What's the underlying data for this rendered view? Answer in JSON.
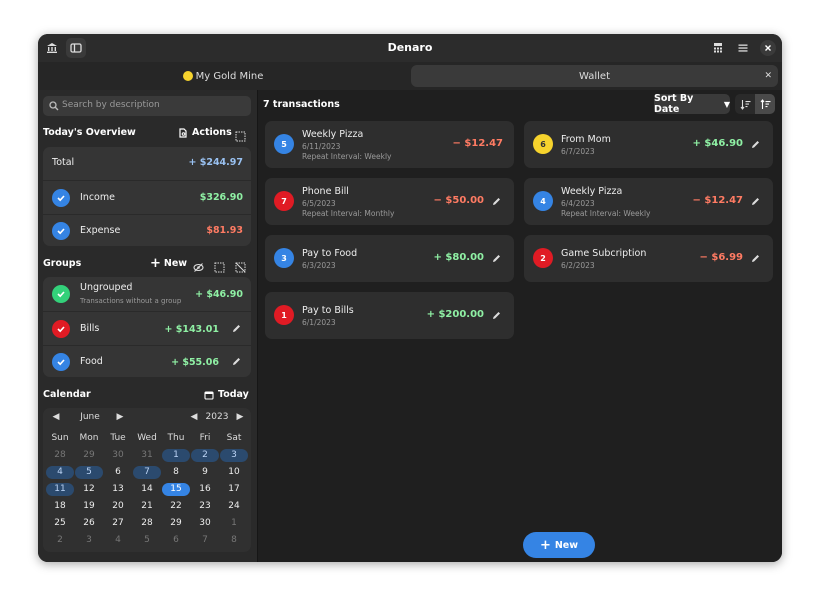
{
  "app": {
    "title": "Denaro"
  },
  "colors": {
    "accent": "#3584e4",
    "positive": "#8ff0a4",
    "negative": "#ff7b63",
    "red_badge": "#e01b24",
    "yellow_badge": "#f6d32d",
    "green_badge": "#33d17a"
  },
  "icons": {
    "bank": "bank-icon",
    "sidebar": "sidebar-toggle-icon",
    "calculator": "calculator-icon",
    "menu": "hamburger-menu-icon",
    "close": "close-icon"
  },
  "tabs": [
    {
      "label": "My Gold Mine",
      "dot_color": "#f6d32d"
    },
    {
      "label": "Wallet"
    }
  ],
  "search": {
    "placeholder": "Search by description"
  },
  "overview": {
    "title": "Today's Overview",
    "actions_label": "Actions",
    "rows": [
      {
        "label": "Total",
        "amount": "+ $244.97"
      },
      {
        "label": "Income",
        "amount": "$326.90"
      },
      {
        "label": "Expense",
        "amount": "$81.93"
      }
    ]
  },
  "groups": {
    "title": "Groups",
    "new_label": "New",
    "items": [
      {
        "name": "Ungrouped",
        "subtitle": "Transactions without a group",
        "amount": "+ $46.90",
        "color": "#33d17a"
      },
      {
        "name": "Bills",
        "amount": "+ $143.01",
        "color": "#e01b24"
      },
      {
        "name": "Food",
        "amount": "+ $55.06",
        "color": "#3584e4"
      }
    ]
  },
  "calendar": {
    "title": "Calendar",
    "today_label": "Today",
    "month": "June",
    "year": "2023",
    "weekdays": [
      "Sun",
      "Mon",
      "Tue",
      "Wed",
      "Thu",
      "Fri",
      "Sat"
    ],
    "weeks": [
      [
        "28",
        "29",
        "30",
        "31",
        "1",
        "2",
        "3"
      ],
      [
        "4",
        "5",
        "6",
        "7",
        "8",
        "9",
        "10"
      ],
      [
        "11",
        "12",
        "13",
        "14",
        "15",
        "16",
        "17"
      ],
      [
        "18",
        "19",
        "20",
        "21",
        "22",
        "23",
        "24"
      ],
      [
        "25",
        "26",
        "27",
        "28",
        "29",
        "30",
        "1"
      ],
      [
        "2",
        "3",
        "4",
        "5",
        "6",
        "7",
        "8"
      ]
    ],
    "today": "15",
    "marked_days": [
      "1",
      "2",
      "3",
      "4",
      "5",
      "7",
      "11"
    ]
  },
  "transactions": {
    "count_label": "7 transactions",
    "sort_label": "Sort By Date",
    "items": [
      {
        "id": "5",
        "name": "Weekly Pizza",
        "date": "6/11/2023",
        "repeat": "Repeat Interval: Weekly",
        "amount": "− $12.47",
        "type": "expense",
        "color": "#3584e4"
      },
      {
        "id": "6",
        "name": "From Mom",
        "date": "6/7/2023",
        "repeat": "",
        "amount": "+ $46.90",
        "type": "income",
        "color": "#f6d32d"
      },
      {
        "id": "7",
        "name": "Phone Bill",
        "date": "6/5/2023",
        "repeat": "Repeat Interval: Monthly",
        "amount": "− $50.00",
        "type": "expense",
        "color": "#e01b24"
      },
      {
        "id": "4",
        "name": "Weekly Pizza",
        "date": "6/4/2023",
        "repeat": "Repeat Interval: Weekly",
        "amount": "− $12.47",
        "type": "expense",
        "color": "#3584e4"
      },
      {
        "id": "3",
        "name": "Pay to Food",
        "date": "6/3/2023",
        "repeat": "",
        "amount": "+ $80.00",
        "type": "income",
        "color": "#3584e4"
      },
      {
        "id": "2",
        "name": "Game Subcription",
        "date": "6/2/2023",
        "repeat": "",
        "amount": "− $6.99",
        "type": "expense",
        "color": "#e01b24"
      },
      {
        "id": "1",
        "name": "Pay to Bills",
        "date": "6/1/2023",
        "repeat": "",
        "amount": "+ $200.00",
        "type": "income",
        "color": "#e01b24"
      }
    ],
    "new_label": "New"
  }
}
